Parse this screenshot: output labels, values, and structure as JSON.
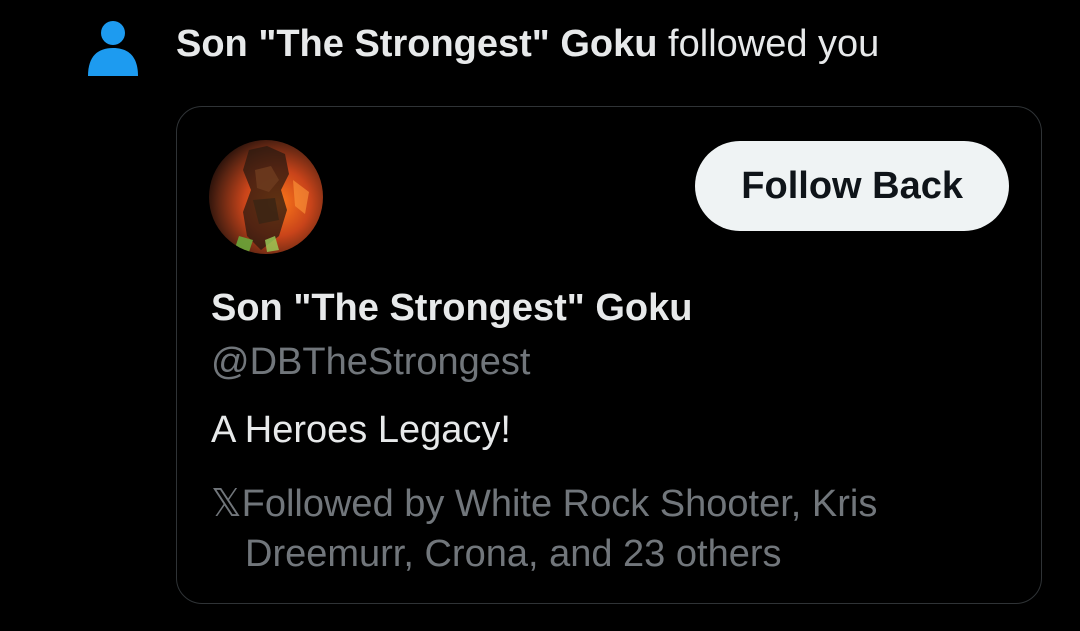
{
  "notification": {
    "actor_name": "Son \"The Strongest\" Goku",
    "action_text": " followed you",
    "icon": "person-icon",
    "icon_color": "#1d9bf0"
  },
  "card": {
    "display_name": "Son \"The Strongest\" Goku",
    "handle": "@DBTheStrongest",
    "bio": "A Heroes Legacy!",
    "follow_button_label": "Follow Back",
    "followed_by_icon": "x-logo-icon",
    "followed_by_icon_glyph": "𝕏",
    "followed_by_line1": "Followed by White Rock Shooter, Kris",
    "followed_by_line2": "Dreemurr, Crona, and 23 others"
  }
}
